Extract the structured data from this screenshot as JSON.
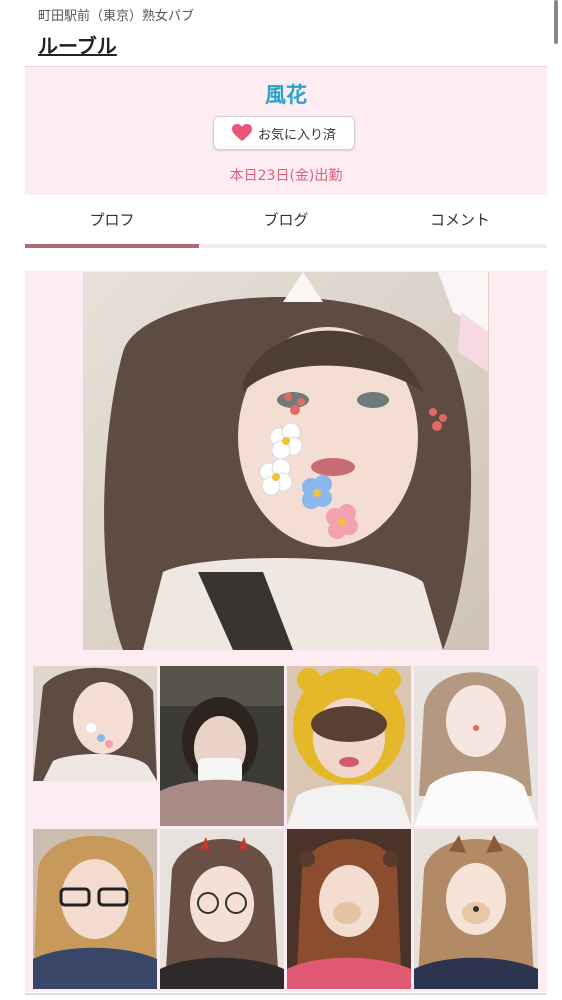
{
  "header": {
    "subtitle": "町田駅前（東京）熟女パブ",
    "shop_name": "ルーブル"
  },
  "profile": {
    "name": "風花",
    "favorite_label": "お気に入り済",
    "attendance": "本日23日(金)出勤"
  },
  "tabs": [
    {
      "label": "プロフ",
      "active": true
    },
    {
      "label": "ブログ",
      "active": false
    },
    {
      "label": "コメント",
      "active": false
    }
  ],
  "colors": {
    "accent_blue": "#2aa3c6",
    "pink_bg": "#fdecf1",
    "attendance_text": "#e0607a",
    "heart": "#e8557a",
    "active_tab": "#b06a72"
  },
  "gallery": {
    "main_photo": "portrait-photo",
    "thumbnails": [
      "thumbnail-photo-1",
      "thumbnail-photo-2",
      "thumbnail-photo-3",
      "thumbnail-photo-4",
      "thumbnail-photo-5",
      "thumbnail-photo-6",
      "thumbnail-photo-7",
      "thumbnail-photo-8"
    ]
  }
}
